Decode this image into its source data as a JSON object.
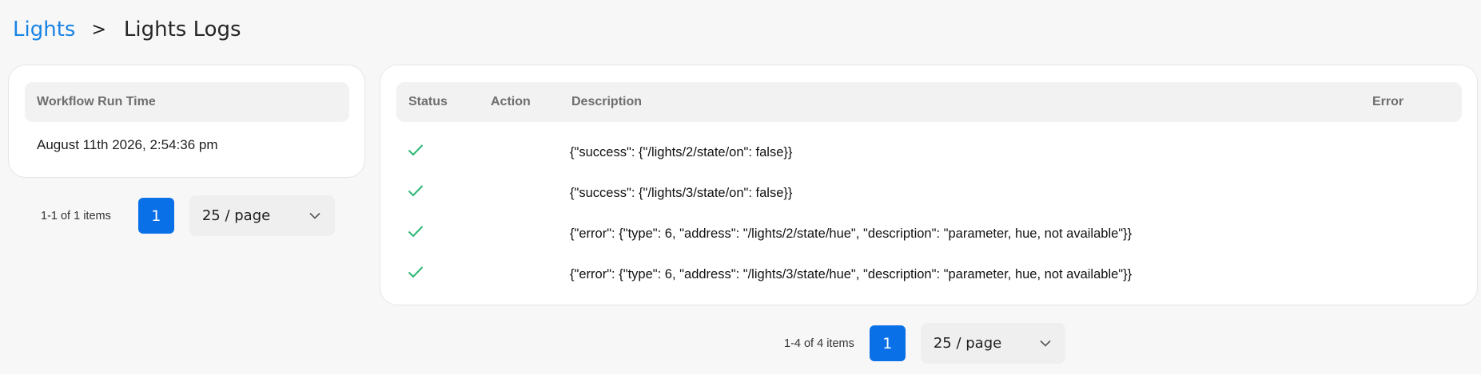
{
  "breadcrumb": {
    "parent": "Lights",
    "separator": ">",
    "current": "Lights Logs"
  },
  "runs": {
    "header": "Workflow Run Time",
    "rows": [
      "August 11th 2026, 2:54:36 pm"
    ],
    "pagination": {
      "count": "1-1 of 1 items",
      "page": "1",
      "page_size": "25 / page"
    }
  },
  "logs": {
    "columns": {
      "status": "Status",
      "action": "Action",
      "description": "Description",
      "error": "Error"
    },
    "rows": [
      {
        "status": "success-check-icon",
        "action": "",
        "description": "{\"success\": {\"/lights/2/state/on\": false}}",
        "error": ""
      },
      {
        "status": "success-check-icon",
        "action": "",
        "description": "{\"success\": {\"/lights/3/state/on\": false}}",
        "error": ""
      },
      {
        "status": "success-check-icon",
        "action": "",
        "description": "{\"error\": {\"type\": 6, \"address\": \"/lights/2/state/hue\", \"description\": \"parameter, hue, not available\"}}",
        "error": ""
      },
      {
        "status": "success-check-icon",
        "action": "",
        "description": "{\"error\": {\"type\": 6, \"address\": \"/lights/3/state/hue\", \"description\": \"parameter, hue, not available\"}}",
        "error": ""
      }
    ],
    "pagination": {
      "count": "1-4 of 4 items",
      "page": "1",
      "page_size": "25 / page"
    }
  },
  "colors": {
    "link": "#1a84e5",
    "primary": "#0a70e8",
    "success": "#2bb673",
    "background": "#f7f7f7"
  }
}
